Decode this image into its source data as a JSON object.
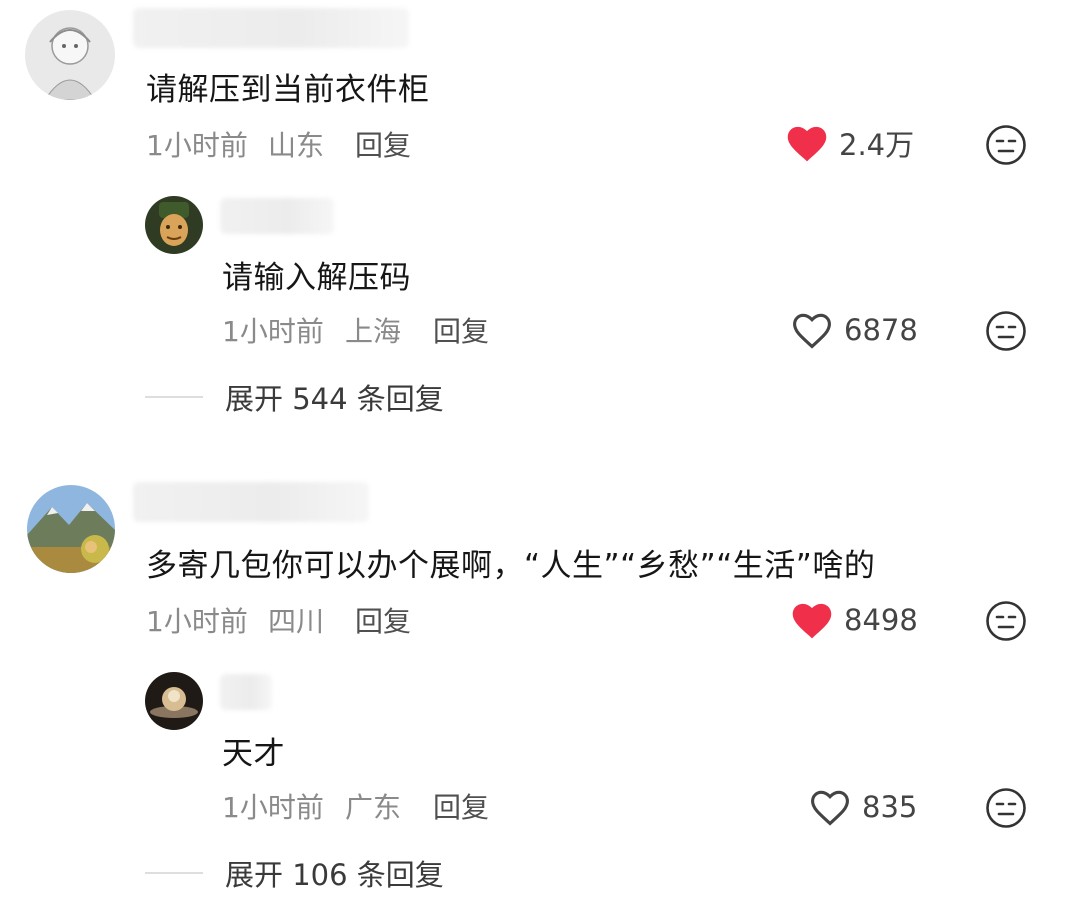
{
  "comments": [
    {
      "text": "请解压到当前衣件柜",
      "time": "1小时前",
      "region": "山东",
      "reply_label": "回复",
      "likes": "2.4万",
      "liked": true,
      "replies": [
        {
          "text": "请输入解压码",
          "time": "1小时前",
          "region": "上海",
          "reply_label": "回复",
          "likes": "6878",
          "liked": false
        }
      ],
      "expand_label": "展开 544 条回复"
    },
    {
      "text": "多寄几包你可以办个展啊，“人生”“乡愁”“生活”啥的",
      "time": "1小时前",
      "region": "四川",
      "reply_label": "回复",
      "likes": "8498",
      "liked": true,
      "replies": [
        {
          "text": "天才",
          "time": "1小时前",
          "region": "广东",
          "reply_label": "回复",
          "likes": "835",
          "liked": false
        }
      ],
      "expand_label": "展开 106 条回复"
    }
  ],
  "colors": {
    "like_active": "#f0304a",
    "text_primary": "#161616",
    "text_meta": "#8a8a8a"
  },
  "icons": {
    "like": "heart-icon",
    "dislike": "unamused-face-icon"
  }
}
